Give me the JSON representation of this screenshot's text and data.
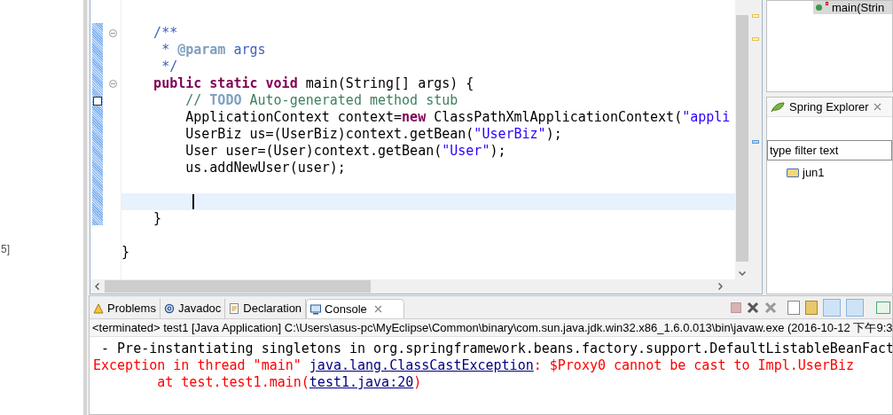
{
  "left_panel": {
    "text": "5]"
  },
  "editor": {
    "lines": [
      {
        "kind": "blank"
      },
      {
        "kind": "blank"
      },
      {
        "fold": true,
        "tokens": [
          {
            "text": "    /**",
            "kind": "javadoc"
          }
        ]
      },
      {
        "tokens": [
          {
            "text": "     * ",
            "kind": "javadoc"
          },
          {
            "text": "@param",
            "kind": "tag"
          },
          {
            "text": " args",
            "kind": "javadoc"
          }
        ]
      },
      {
        "tokens": [
          {
            "text": "     */",
            "kind": "javadoc"
          }
        ]
      },
      {
        "fold": true,
        "tokens": [
          {
            "text": "    public static void",
            "kind": "keyword"
          },
          {
            "text": " main(String[] args) {",
            "kind": "plain"
          }
        ]
      },
      {
        "task": true,
        "tokens": [
          {
            "text": "        // ",
            "kind": "comment"
          },
          {
            "text": "TODO",
            "kind": "todo"
          },
          {
            "text": " Auto-generated method stub",
            "kind": "comment"
          }
        ]
      },
      {
        "tokens": [
          {
            "text": "        ApplicationContext context=",
            "kind": "plain"
          },
          {
            "text": "new",
            "kind": "keyword"
          },
          {
            "text": " ClassPathXmlApplicationContext(",
            "kind": "plain"
          },
          {
            "text": "\"appli",
            "kind": "string"
          }
        ]
      },
      {
        "tokens": [
          {
            "text": "        UserBiz us=(UserBiz)context.getBean(",
            "kind": "plain"
          },
          {
            "text": "\"UserBiz\"",
            "kind": "string"
          },
          {
            "text": ");",
            "kind": "plain"
          }
        ]
      },
      {
        "tokens": [
          {
            "text": "        User user=(User)context.getBean(",
            "kind": "plain"
          },
          {
            "text": "\"User\"",
            "kind": "string"
          },
          {
            "text": ");",
            "kind": "plain"
          }
        ]
      },
      {
        "tokens": [
          {
            "text": "        us.addNewUser(user);",
            "kind": "plain"
          }
        ]
      },
      {
        "kind": "blank"
      },
      {
        "current": true
      },
      {
        "tokens": [
          {
            "text": "    }",
            "kind": "plain"
          }
        ]
      },
      {
        "kind": "blank"
      },
      {
        "tokens": [
          {
            "text": "}",
            "kind": "plain"
          }
        ]
      }
    ]
  },
  "outline": {
    "item": {
      "label": "main(Strin",
      "selected": true
    }
  },
  "spring_explorer": {
    "title": "Spring Explorer",
    "filter": {
      "placeholder": "type filter text"
    },
    "tree": [
      {
        "label": "jun1"
      }
    ]
  },
  "console": {
    "tabs": [
      {
        "label": "Problems",
        "selected": false
      },
      {
        "label": "Javadoc",
        "selected": false
      },
      {
        "label": "Declaration",
        "selected": false
      },
      {
        "label": "Console",
        "selected": true
      }
    ],
    "description": "<terminated> test1 [Java Application] C:\\Users\\asus-pc\\MyEclipse\\Common\\binary\\com.sun.java.jdk.win32.x86_1.6.0.013\\bin\\javaw.exe (2016-10-12 下午9:3",
    "lines": [
      [
        {
          "text": " - Pre-instantiating singletons in org.springframework.beans.factory.support.DefaultListableBeanFact",
          "kind": "plain"
        }
      ],
      [
        {
          "text": "Exception in thread \"main\" ",
          "kind": "error"
        },
        {
          "text": "java.lang.ClassCastException",
          "kind": "link"
        },
        {
          "text": ": $Proxy0 cannot be cast to Impl.UserBiz",
          "kind": "error"
        }
      ],
      [
        {
          "text": "        at test.test1.main(",
          "kind": "error"
        },
        {
          "text": "test1.java:20",
          "kind": "link"
        },
        {
          "text": ")",
          "kind": "error"
        }
      ]
    ]
  }
}
